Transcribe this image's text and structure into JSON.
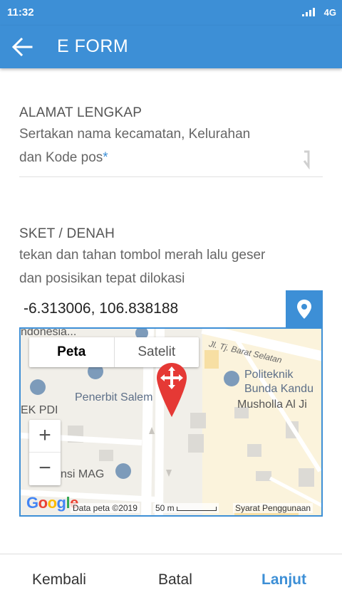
{
  "status": {
    "time": "11:32",
    "network": "4G"
  },
  "appbar": {
    "title": "E FORM",
    "back_icon": "arrow-left-icon"
  },
  "address_field": {
    "label": "ALAMAT LENGKAP",
    "hint_line1": "Sertakan nama kecamatan, Kelurahan",
    "hint_line2": "dan Kode pos",
    "required_mark": "*"
  },
  "sketch_field": {
    "label": "SKET / DENAH",
    "hint_line1": "tekan dan tahan tombol merah lalu geser",
    "hint_line2": "dan posisikan tepat dilokasi"
  },
  "coordinates": {
    "value": "-6.313006, 106.838188",
    "button_icon": "location-pin-icon"
  },
  "map": {
    "type_options": [
      "Peta",
      "Satelit"
    ],
    "selected_type": "Peta",
    "zoom_in": "+",
    "zoom_out": "−",
    "labels": {
      "indonesia": "ndonesia...",
      "street": "Jl. Tj. Barat Selatan",
      "politeknik_1": "Politeknik",
      "politeknik_2": "Bunda Kandu",
      "musholla": "Musholla Al Ji",
      "penerbit": "Penerbit Salem",
      "ek_pdi": "EK PDI",
      "nsi_mag": "nsi MAG"
    },
    "attribution": {
      "data": "Data peta ©2019",
      "scale": "50 m",
      "terms": "Syarat Penggunaan"
    },
    "logo": "Google",
    "colors": {
      "marker": "#e53935",
      "accent": "#3d8fd6"
    }
  },
  "footer": {
    "back": "Kembali",
    "cancel": "Batal",
    "next": "Lanjut"
  }
}
